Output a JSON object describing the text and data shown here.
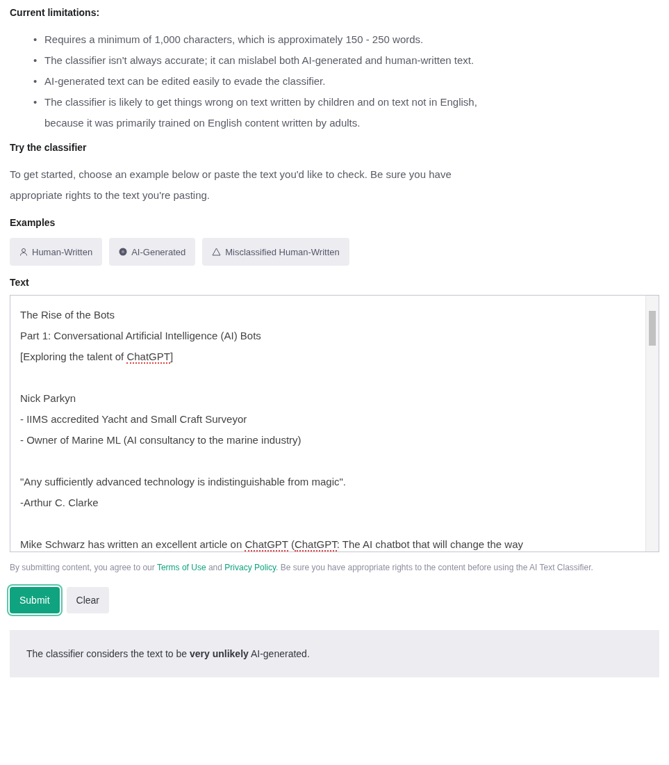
{
  "limitations": {
    "heading": "Current limitations:",
    "marker": "•",
    "items": [
      "Requires a minimum of 1,000 characters, which is approximately 150 - 250 words.",
      "The classifier isn't always accurate; it can mislabel both AI-generated and human-written text.",
      "AI-generated text can be edited easily to evade the classifier.",
      "The classifier is likely to get things wrong on text written by children and on text not in English, because it was primarily trained on English content written by adults."
    ]
  },
  "try": {
    "heading": "Try the classifier",
    "intro": "To get started, choose an example below or paste the text you'd like to check. Be sure you have appropriate rights to the text you're pasting."
  },
  "examples": {
    "heading": "Examples",
    "buttons": [
      {
        "label": "Human-Written",
        "kind": "person"
      },
      {
        "label": "AI-Generated",
        "kind": "ai"
      },
      {
        "label": "Misclassified Human-Written",
        "kind": "warning"
      }
    ]
  },
  "text": {
    "label": "Text",
    "paragraphs": [
      {
        "lines": [
          [
            {
              "t": "The Rise of the Bots",
              "misspelled": false
            }
          ],
          [
            {
              "t": "Part 1: Conversational Artificial Intelligence (AI) Bots",
              "misspelled": false
            }
          ],
          [
            {
              "t": " [Exploring the talent of ",
              "misspelled": false
            },
            {
              "t": "ChatGPT",
              "misspelled": true
            },
            {
              "t": "]",
              "misspelled": false
            }
          ]
        ]
      },
      {
        "lines": [
          [
            {
              "t": "Nick Parkyn",
              "misspelled": false
            }
          ],
          [
            {
              "t": "- IIMS accredited Yacht and Small Craft Surveyor",
              "misspelled": false
            }
          ],
          [
            {
              "t": "- Owner of Marine ML (AI consultancy to the marine industry)",
              "misspelled": false
            }
          ]
        ]
      },
      {
        "lines": [
          [
            {
              "t": " \"Any sufficiently advanced technology is indistinguishable from magic\".",
              "misspelled": false
            }
          ],
          [
            {
              "t": "-Arthur C. Clarke",
              "misspelled": false
            }
          ]
        ]
      },
      {
        "lines": [
          [
            {
              "t": "Mike Schwarz has written an excellent article on ",
              "misspelled": false
            },
            {
              "t": "ChatGPT",
              "misspelled": true
            },
            {
              "t": " (",
              "misspelled": false
            },
            {
              "t": "ChatGPT",
              "misspelled": true
            },
            {
              "t": ": The AI chatbot that will change the way",
              "misspelled": false
            }
          ]
        ]
      }
    ]
  },
  "terms": {
    "before": "By submitting content, you agree to our ",
    "link1": "Terms of Use",
    "middle": " and ",
    "link2": "Privacy Policy",
    "after": ". Be sure you have appropriate rights to the content before using the AI Text Classifier."
  },
  "actions": [
    {
      "label": "Submit",
      "kind": "primary"
    },
    {
      "label": "Clear",
      "kind": "secondary"
    }
  ],
  "result": "The classifier considers the text to be **very unlikely** AI-generated."
}
